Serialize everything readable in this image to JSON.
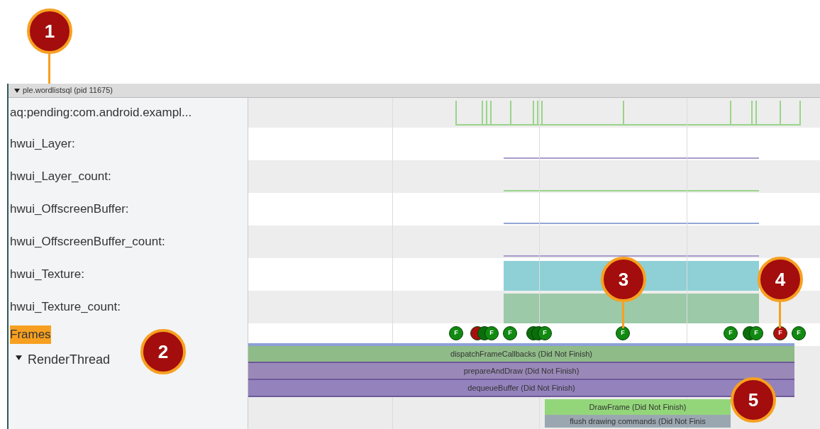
{
  "process": {
    "title": "ple.wordlistsql (pid 11675)",
    "expanded": true
  },
  "counter_tracks": [
    {
      "label": "aq:pending:com.android.exampl...",
      "kind": "pulses",
      "color": "#9ad48a"
    },
    {
      "label": "hwui_Layer:",
      "kind": "line",
      "color": "#a99ccc"
    },
    {
      "label": "hwui_Layer_count:",
      "kind": "line",
      "color": "#9ad48a"
    },
    {
      "label": "hwui_OffscreenBuffer:",
      "kind": "line",
      "color": "#94a6d6"
    },
    {
      "label": "hwui_OffscreenBuffer_count:",
      "kind": "line",
      "color": "#a99ccc"
    },
    {
      "label": "hwui_Texture:",
      "kind": "area",
      "color": "#8ed0d6"
    },
    {
      "label": "hwui_Texture_count:",
      "kind": "area",
      "color": "#9cc9a8"
    }
  ],
  "frames_track": {
    "label": "Frames",
    "selected": true,
    "markers": [
      {
        "label": "F",
        "color": "#118a11"
      },
      {
        "color": "#a80e0e"
      },
      {
        "color": "#0b6e0b"
      },
      {
        "label": "F",
        "color": "#118a11"
      },
      {
        "label": "F",
        "color": "#118a11"
      },
      {
        "color": "#0b6e0b"
      },
      {
        "color": "#0b6e0b"
      },
      {
        "label": "F",
        "color": "#118a11"
      },
      {
        "label": "F",
        "color": "#118a11"
      },
      {
        "label": "F",
        "color": "#118a11"
      },
      {
        "color": "#0b6e0b"
      },
      {
        "label": "F",
        "color": "#118a11"
      },
      {
        "label": "F",
        "color": "#b30f0f"
      },
      {
        "label": "F",
        "color": "#118a11"
      }
    ]
  },
  "thread": {
    "label": "RenderThread",
    "expanded": true,
    "slices": [
      {
        "label": "dispatchFrameCallbacks (Did Not Finish)",
        "color": "#8fbb88"
      },
      {
        "label": "prepareAndDraw (Did Not Finish)",
        "color": "#9a88b8"
      },
      {
        "label": "dequeueBuffer (Did Not Finish)",
        "color": "#9482bd"
      }
    ],
    "sub_slices": [
      {
        "label": "DrawFrame (Did Not Finish)",
        "color": "#93d67a"
      },
      {
        "label": "flush drawing commands (Did Not Finis",
        "color": "#9aa7b0"
      }
    ]
  },
  "callouts": [
    "1",
    "2",
    "3",
    "4",
    "5"
  ]
}
